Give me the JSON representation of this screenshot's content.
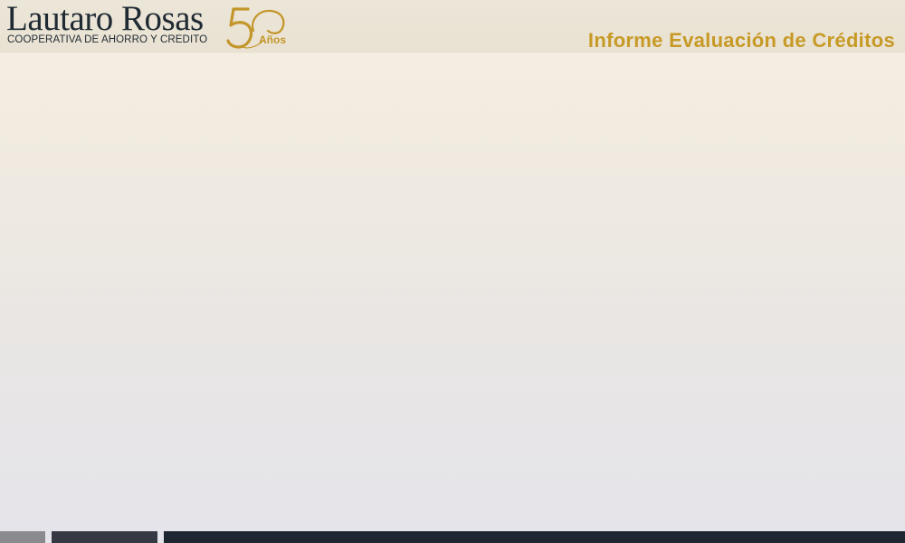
{
  "header": {
    "brand": {
      "name": "Lautaro Rosas",
      "subtitle": "COOPERATIVA DE AHORRO Y CREDITO",
      "anniversary_number": "50",
      "anniversary_label": "Años"
    },
    "report_title": "Informe Evaluación de Créditos"
  },
  "colors": {
    "accent_gold": "#c79a26",
    "brand_dark": "#1f2a33",
    "footer_dark": "#1d2631"
  }
}
